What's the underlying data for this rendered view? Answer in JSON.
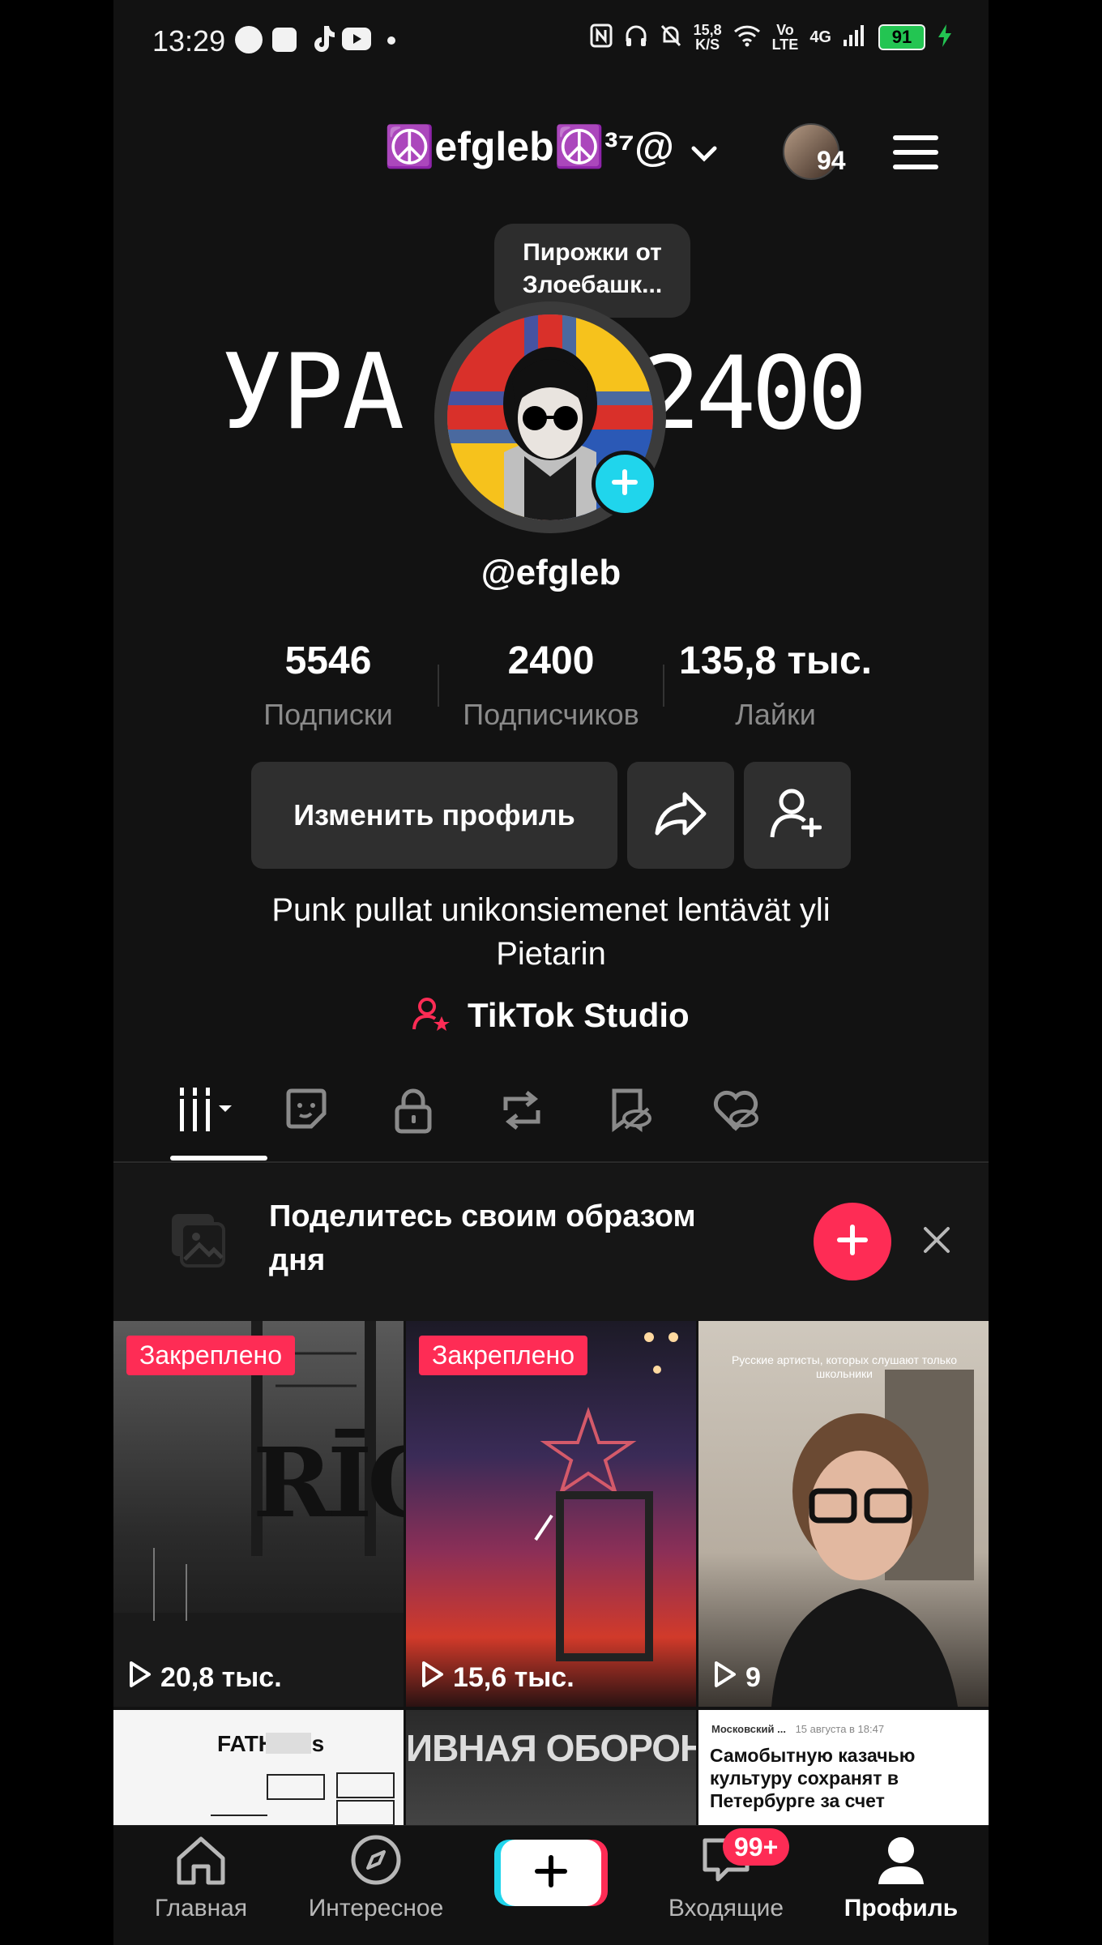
{
  "status_bar": {
    "time": "13:29",
    "net_speed_top": "15,8",
    "net_speed_bottom": "K/S",
    "volte_top": "Vo",
    "volte_bottom": "LTE",
    "network": "4G",
    "battery": "91"
  },
  "header": {
    "username": "☮️efgleb☮️³⁷@",
    "notification_count": "94"
  },
  "profile": {
    "tooltip": "Пирожки от Злоебашк...",
    "side_left": "УРА",
    "side_right": "2400",
    "handle": "@efgleb",
    "stats": [
      {
        "value": "5546",
        "label": "Подписки"
      },
      {
        "value": "2400",
        "label": "Подписчиков"
      },
      {
        "value": "135,8 тыс.",
        "label": "Лайки"
      }
    ],
    "edit_button": "Изменить профиль",
    "bio": "Punk pullat unikonsiemenet lentävät yli Pietarin",
    "studio": "TikTok Studio"
  },
  "banner": {
    "text": "Поделитесь своим образом дня"
  },
  "videos": [
    {
      "pinned": "Закреплено",
      "views": "20,8 тыс.",
      "overlay_text": "RĪGA"
    },
    {
      "pinned": "Закреплено",
      "views": "15,6 тыс."
    },
    {
      "views": "9",
      "caption": "Русские артисты, которых слушают только школьники"
    },
    {
      "overlay_text": "FATHER's"
    },
    {
      "overlay_text": "ИВНАЯ ОБОРОН"
    },
    {
      "source": "Московский ...",
      "date": "15 августа в 18:47",
      "headline": "Самобытную казачью культуру сохранят в Петербурге за счет"
    }
  ],
  "bottom_nav": {
    "home": "Главная",
    "explore": "Интересное",
    "inbox": "Входящие",
    "inbox_badge": "99+",
    "profile": "Профиль"
  },
  "colors": {
    "accent": "#fe2c55",
    "cyan": "#20d5ec",
    "background": "#121212"
  },
  "icons": [
    "notification-icon",
    "square-icon",
    "tiktok-icon",
    "youtube-icon",
    "nfc-icon",
    "headphones-icon",
    "mute-icon",
    "wifi-icon",
    "signal-icon",
    "charging-icon",
    "chevron-down-icon",
    "menu-icon",
    "plus-icon",
    "share-icon",
    "add-friend-icon",
    "studio-icon",
    "grid-icon",
    "sticker-icon",
    "lock-icon",
    "repost-icon",
    "saved-hidden-icon",
    "liked-hidden-icon",
    "gallery-icon",
    "close-icon",
    "play-icon",
    "home-icon",
    "compass-icon",
    "inbox-icon",
    "profile-icon"
  ]
}
